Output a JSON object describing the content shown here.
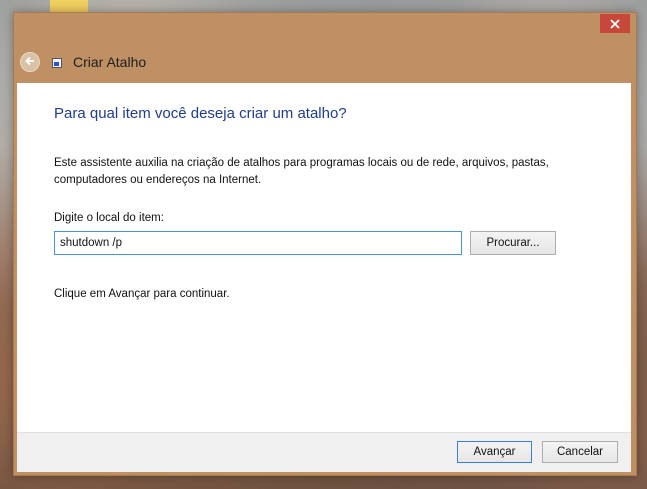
{
  "window": {
    "title": "Criar Atalho"
  },
  "main": {
    "heading": "Para qual item você deseja criar um atalho?",
    "description": "Este assistente auxilia na criação de atalhos para programas locais ou de rede, arquivos, pastas, computadores ou endereços na Internet.",
    "location_label": "Digite o local do item:",
    "location_value": "shutdown /p",
    "browse_label": "Procurar...",
    "hint": "Clique em Avançar para continuar."
  },
  "footer": {
    "next_label": "Avançar",
    "cancel_label": "Cancelar"
  },
  "colors": {
    "title_bar": "#bf9064",
    "close_button": "#c7473b",
    "heading_text": "#1f3d8a",
    "focus_border": "#4f8fd6"
  },
  "icons": {
    "close": "close-icon",
    "back": "back-arrow-icon",
    "app": "shortcut-icon"
  }
}
